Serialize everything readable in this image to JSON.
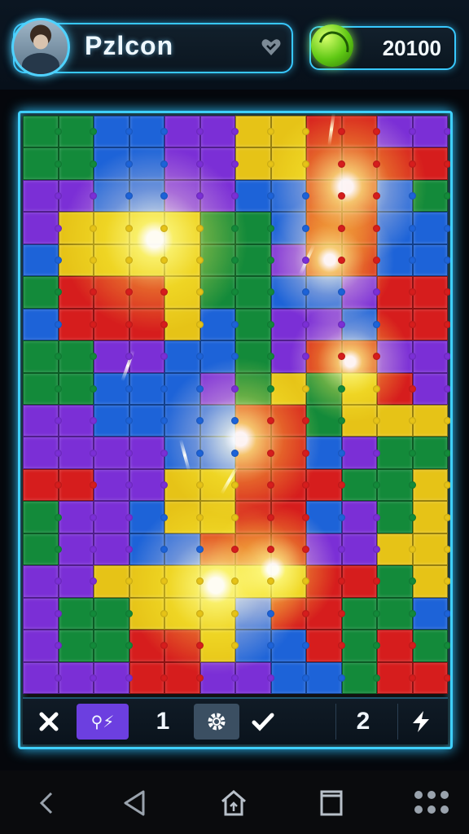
{
  "header": {
    "player_name": "Pzlcon",
    "coins": "20100"
  },
  "toolbar": {
    "close_icon": "close-icon",
    "mode_label": "⚲⚡",
    "count_left": "1",
    "count_right": "2",
    "gear_icon": "gear-icon",
    "check_icon": "check-icon",
    "bolt_icon": "bolt-icon"
  },
  "colors": {
    "accent": "#38c8ff",
    "purple": "#7b2fd6",
    "blue": "#1d63d8",
    "green": "#138a3a",
    "red": "#d61d1d",
    "yellow": "#e6c317"
  },
  "board": {
    "rows": 18,
    "cols": 12,
    "grid": [
      "GGBBPPYYRRPP",
      "GGBBPPYYRRRR",
      "PPBBPPBBRRBG",
      "PYYYYGGBRRBB",
      "BYYYYGGPRRBB",
      "GRRRYGGBBPRR",
      "BRRRYBGPPBRR",
      "GGPPBBGPRRPP",
      "GGBBBPGYGYRP",
      "PPBBBBRRGYYY",
      "PPPPBBRRBPGG",
      "RRPPYYRRRGGY",
      "GPPBYYRRBPGY",
      "GPPBBRRRPPYY",
      "PPYYYYYYRRGY",
      "PGGYYYBRRGGB",
      "PGGRRYBBRGRG",
      "PPPRRPPBBGRR"
    ]
  },
  "navigation": {
    "back_icon": "back-chevron-icon",
    "triangle_icon": "back-triangle-icon",
    "home_icon": "home-icon",
    "recents_icon": "recents-icon",
    "apps_icon": "apps-grid-icon"
  }
}
